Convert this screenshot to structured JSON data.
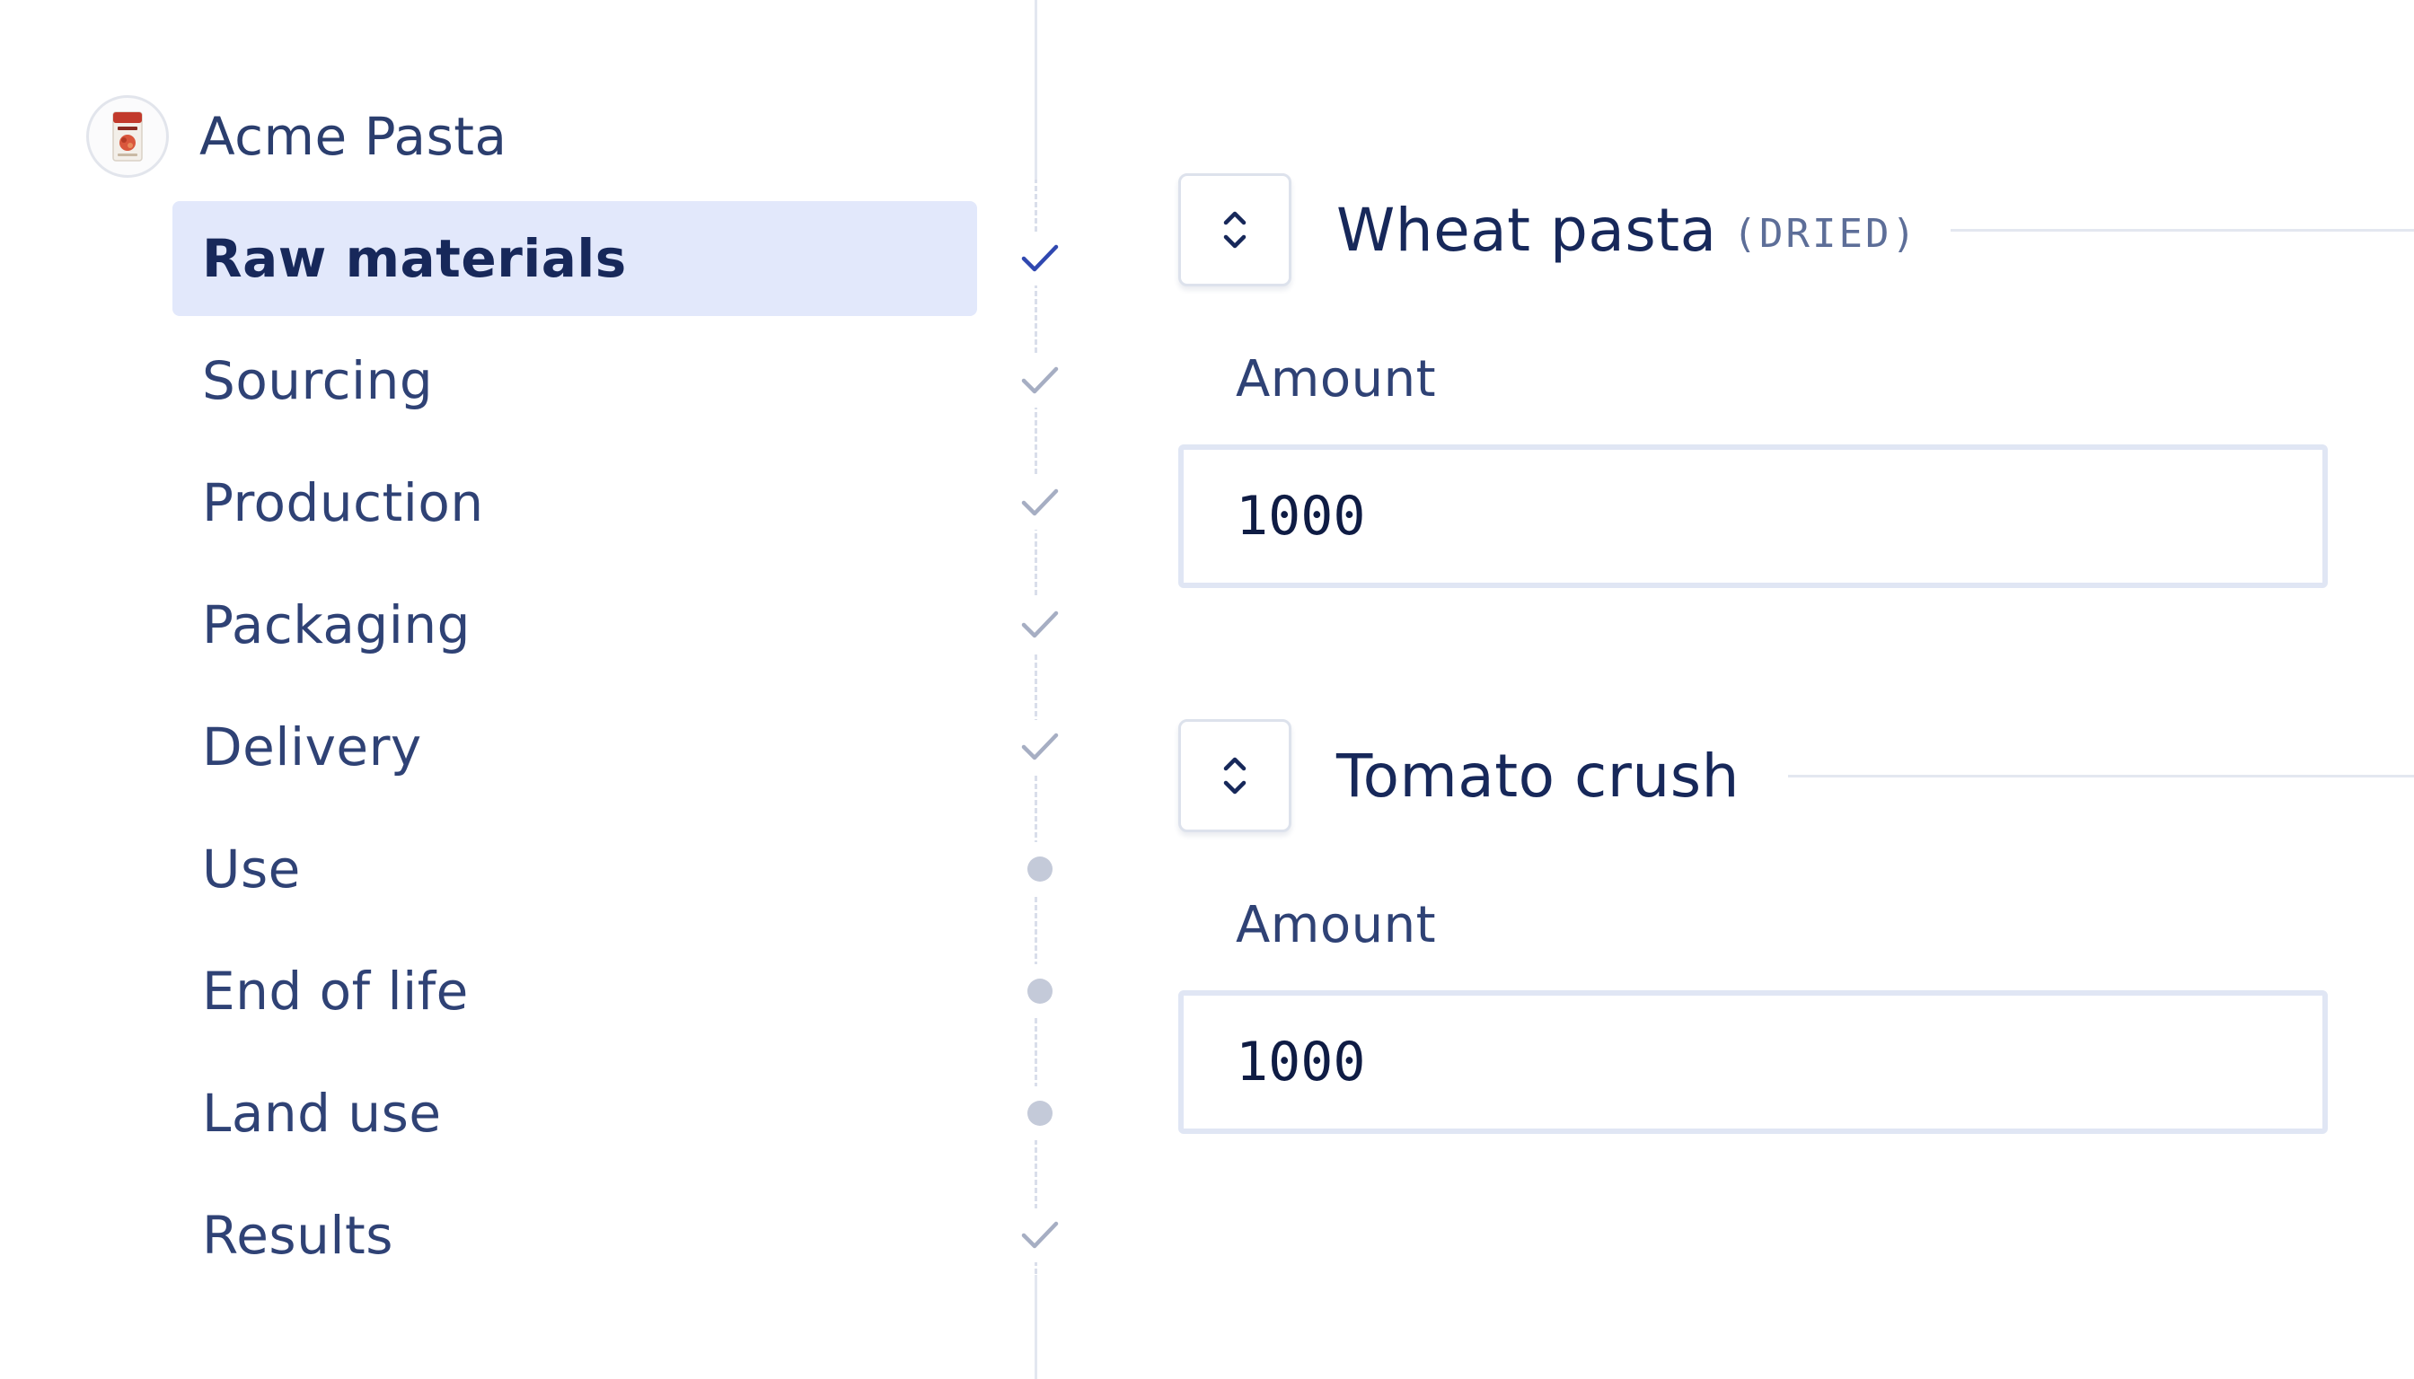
{
  "product": {
    "name": "Acme Pasta",
    "avatar_icon": "pasta-package-icon"
  },
  "nav": {
    "items": [
      {
        "label": "Raw materials",
        "status": "complete",
        "active": true
      },
      {
        "label": "Sourcing",
        "status": "complete",
        "active": false
      },
      {
        "label": "Production",
        "status": "complete",
        "active": false
      },
      {
        "label": "Packaging",
        "status": "complete",
        "active": false
      },
      {
        "label": "Delivery",
        "status": "complete",
        "active": false
      },
      {
        "label": "Use",
        "status": "pending",
        "active": false
      },
      {
        "label": "End of life",
        "status": "pending",
        "active": false
      },
      {
        "label": "Land use",
        "status": "pending",
        "active": false
      },
      {
        "label": "Results",
        "status": "complete",
        "active": false
      }
    ]
  },
  "ingredients": [
    {
      "name": "Wheat pasta",
      "tag": "(DRIED)",
      "amount_label": "Amount",
      "amount_value": "1000"
    },
    {
      "name": "Tomato crush",
      "tag": "",
      "amount_label": "Amount",
      "amount_value": "1000"
    }
  ],
  "colors": {
    "active_bg": "#e2e8fb",
    "active_check": "#3048b0",
    "done_check": "#a6aec3",
    "pending_dot": "#c4cad9",
    "text": "#2f4275",
    "heading": "#17285a"
  }
}
